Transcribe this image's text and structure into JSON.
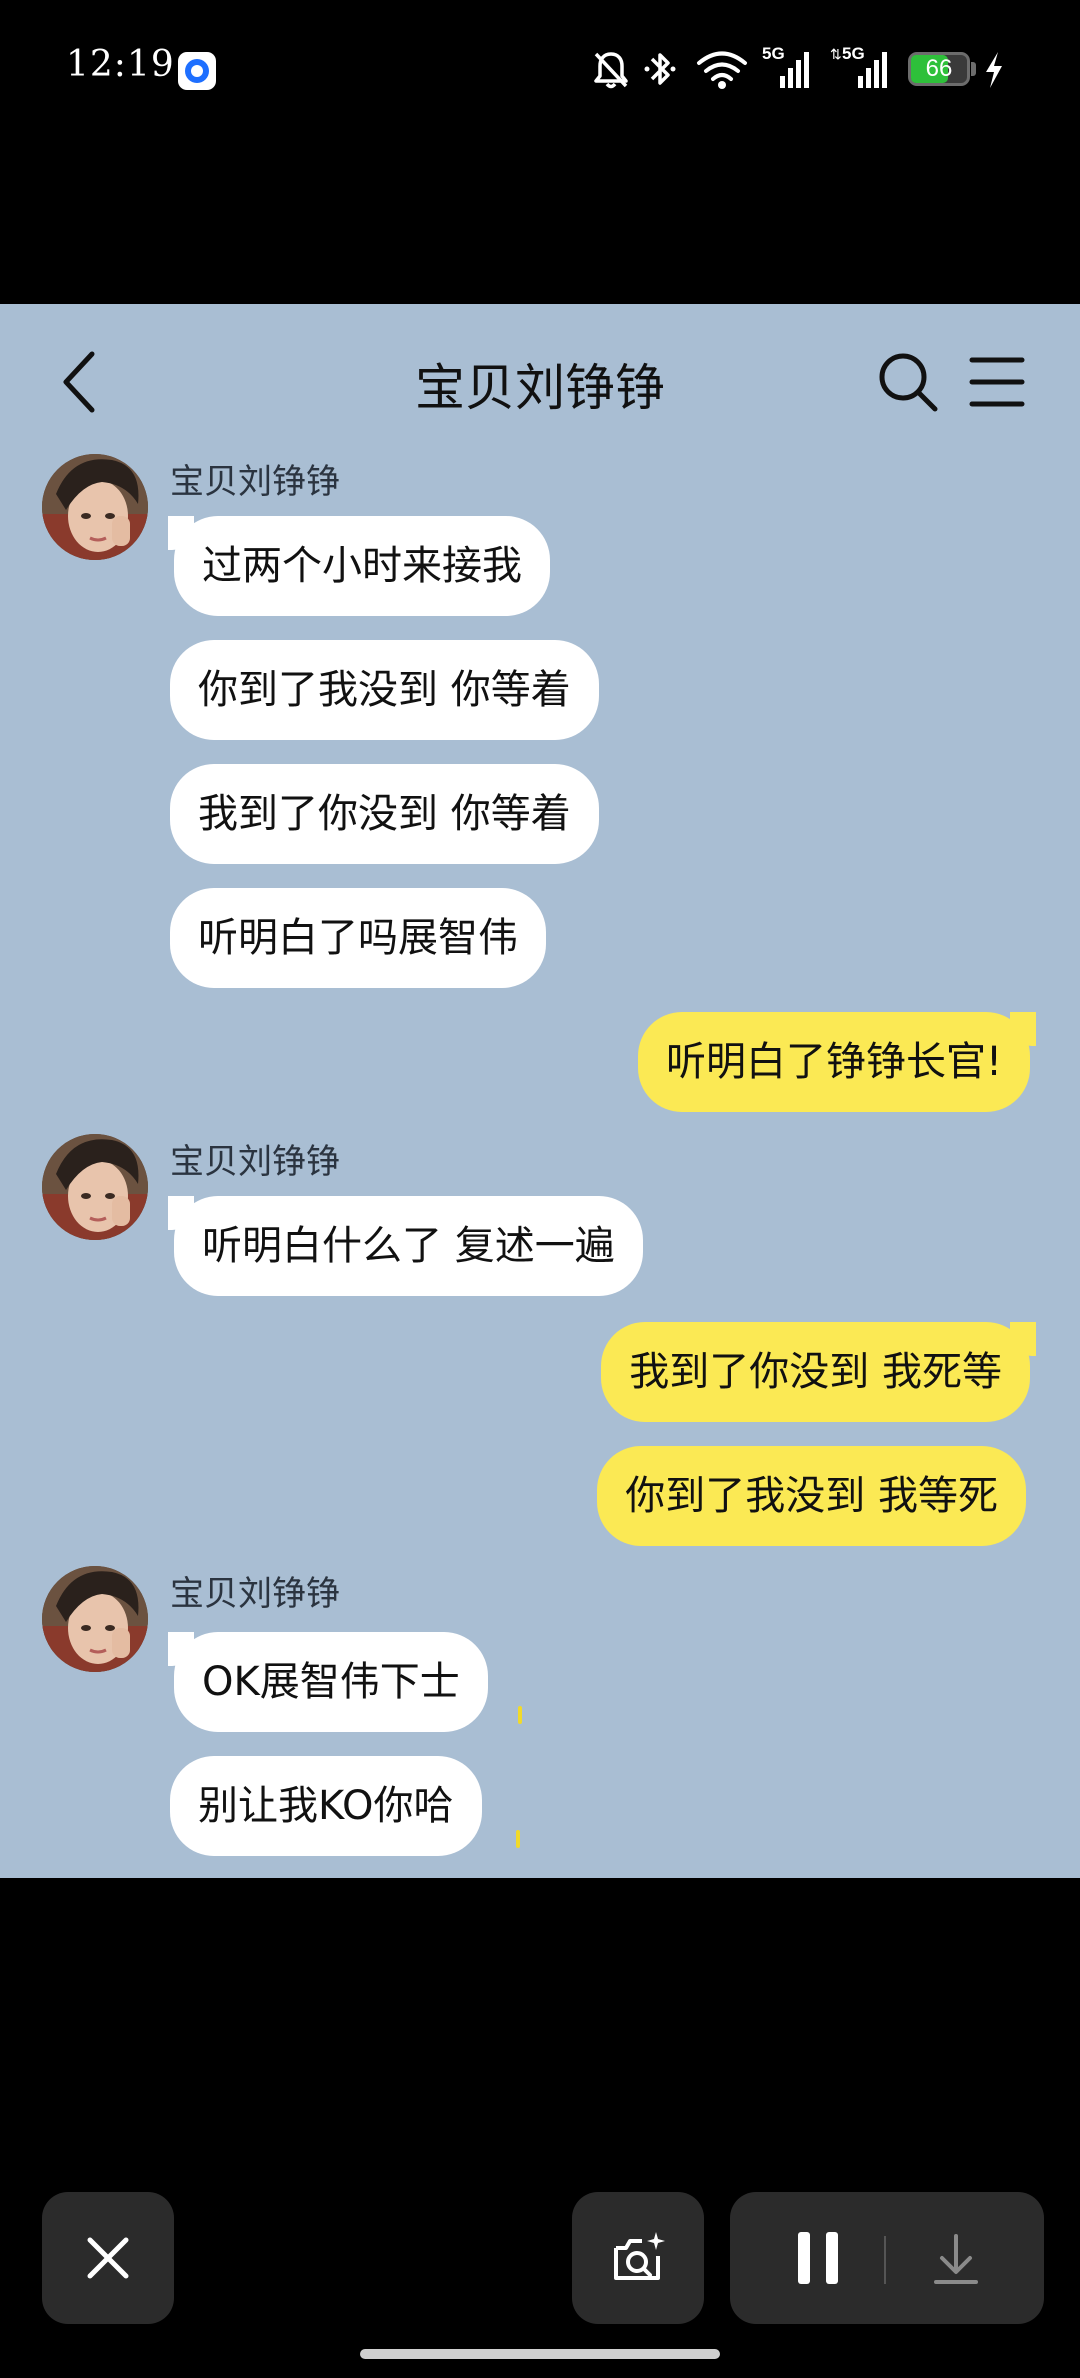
{
  "status_bar": {
    "time": "12:19",
    "app_icon": "circle-app-icon",
    "icons": [
      "bell-off-icon",
      "bluetooth-icon",
      "wifi-icon",
      "5g-signal-icon",
      "5g-signal-icon"
    ],
    "network_label_1": "5G",
    "network_label_2": "5G",
    "battery_level": "66",
    "battery_fraction": 0.66,
    "charging_icon": "lightning-icon"
  },
  "chat": {
    "title": "宝贝刘铮铮",
    "background_color": "#a9bed3",
    "back_icon": "chevron-left-icon",
    "search_icon": "search-icon",
    "menu_icon": "hamburger-menu-icon"
  },
  "messages": {
    "group1_sender": "宝贝刘铮铮",
    "m1": "过两个小时来接我",
    "m2": "你到了我没到 你等着",
    "m3": "我到了你没到 你等着",
    "m4": "听明白了吗展智伟",
    "m5": "听明白了铮铮长官!",
    "group2_sender": "宝贝刘铮铮",
    "m6": "听明白什么了 复述一遍",
    "m7": "我到了你没到 我死等",
    "m8": "你到了我没到 我等死",
    "group3_sender": "宝贝刘铮铮",
    "m9": "OK展智伟下士",
    "m10": "别让我KO你哈"
  },
  "controls": {
    "close_icon": "close-icon",
    "screenshot_icon": "camera-sparkle-icon",
    "pause_icon": "pause-icon",
    "download_icon": "download-icon"
  },
  "colors": {
    "incoming_bubble": "#ffffff",
    "outgoing_bubble": "#fbe954",
    "battery_green": "#2ec03a",
    "control_bg": "#2b2b2b"
  }
}
